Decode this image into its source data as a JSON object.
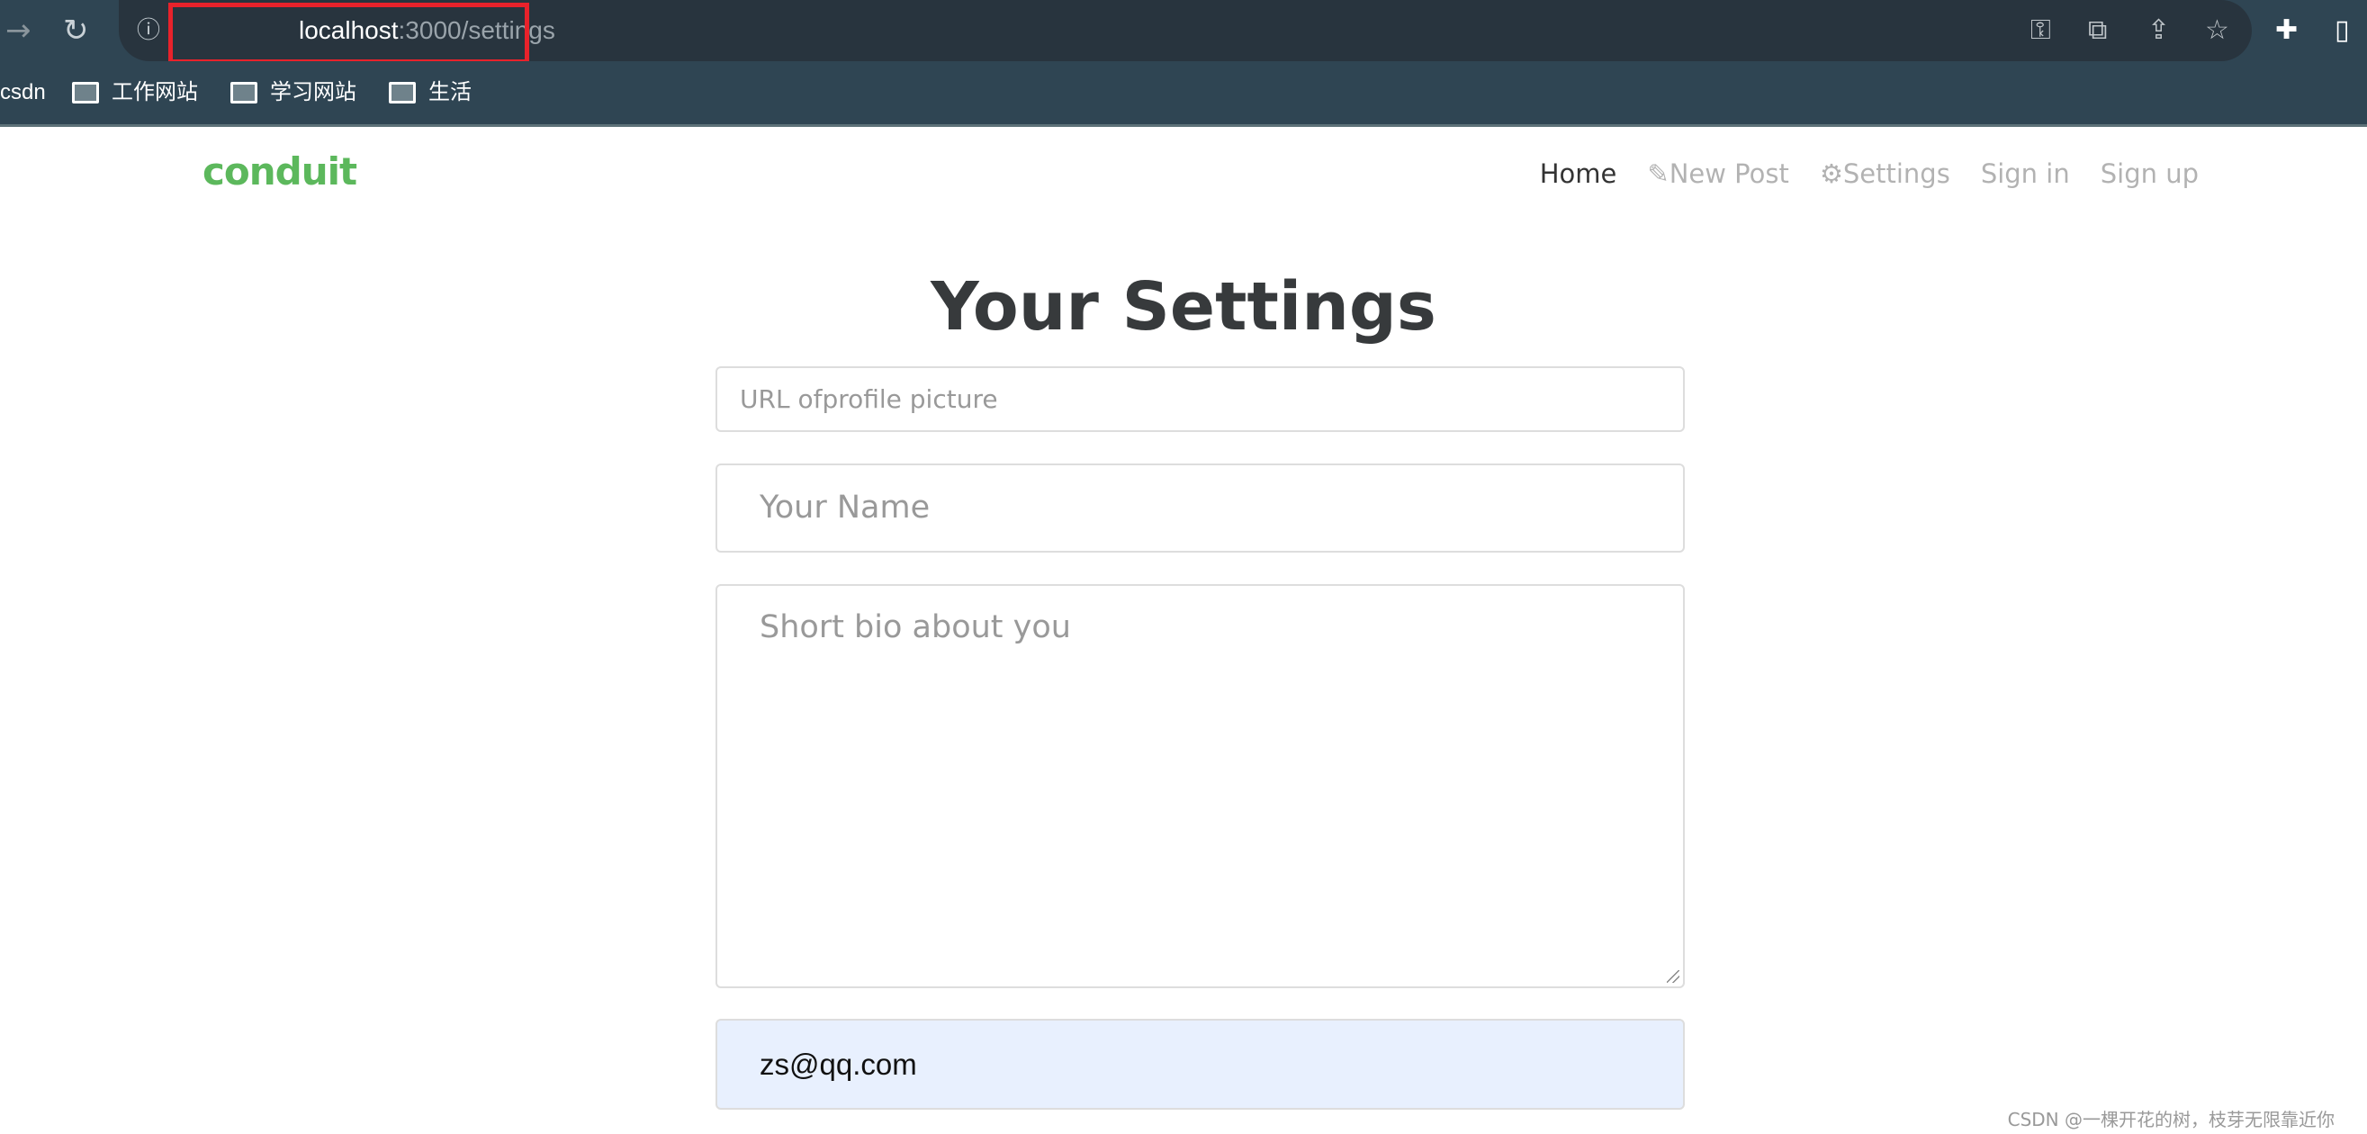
{
  "browser": {
    "url_host": "localhost",
    "url_path": ":3000/settings",
    "highlight_color": "#e8222b",
    "bookmarks": [
      {
        "label": "csdn"
      },
      {
        "label": "工作网站"
      },
      {
        "label": "学习网站"
      },
      {
        "label": "生活"
      }
    ]
  },
  "app": {
    "brand": "conduit",
    "brand_color": "#5cb85c",
    "nav": {
      "home": "Home",
      "new_post": "New Post",
      "settings": "Settings",
      "sign_in": "Sign in",
      "sign_up": "Sign up"
    }
  },
  "page": {
    "title": "Your Settings",
    "form": {
      "image_placeholder": "URL ofprofile picture",
      "name_placeholder": "Your Name",
      "bio_placeholder": "Short bio about you",
      "email_value": "zs@qq.com"
    }
  },
  "watermark": "CSDN @一棵开花的树，枝芽无限靠近你"
}
